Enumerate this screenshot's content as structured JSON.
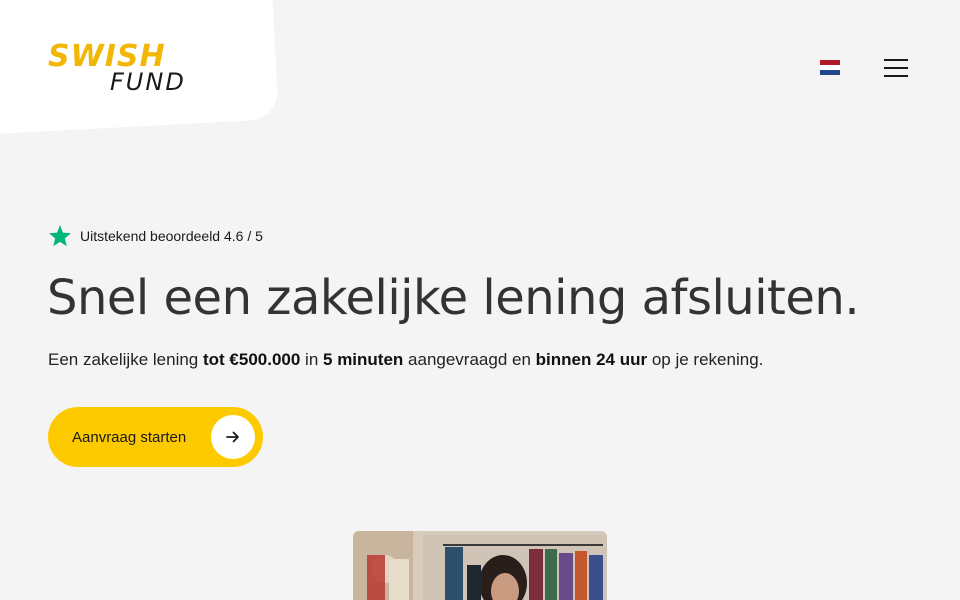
{
  "brand": {
    "logo_top": "SWISH",
    "logo_bottom": "FUND",
    "accent_color": "#fdca00",
    "logo_yellow": "#f2b705"
  },
  "header": {
    "language_flag": "nl-flag-icon",
    "flag_colors": [
      "#ae1c28",
      "#ffffff",
      "#21468b"
    ],
    "menu_icon": "hamburger-icon"
  },
  "hero": {
    "rating_icon": "star-icon",
    "rating_color": "#00b67a",
    "rating_text": "Uitstekend beoordeeld 4.6 / 5",
    "title": "Snel een zakelijke lening afsluiten.",
    "subtitle": {
      "p1": "Een zakelijke lening ",
      "b1": "tot €500.000",
      "p2": " in ",
      "b2": "5 minuten",
      "p3": " aangevraagd en ",
      "b3": "binnen 24 uur",
      "p4": " op je rekening."
    },
    "cta_label": "Aanvraag starten",
    "cta_icon": "arrow-right-icon"
  }
}
